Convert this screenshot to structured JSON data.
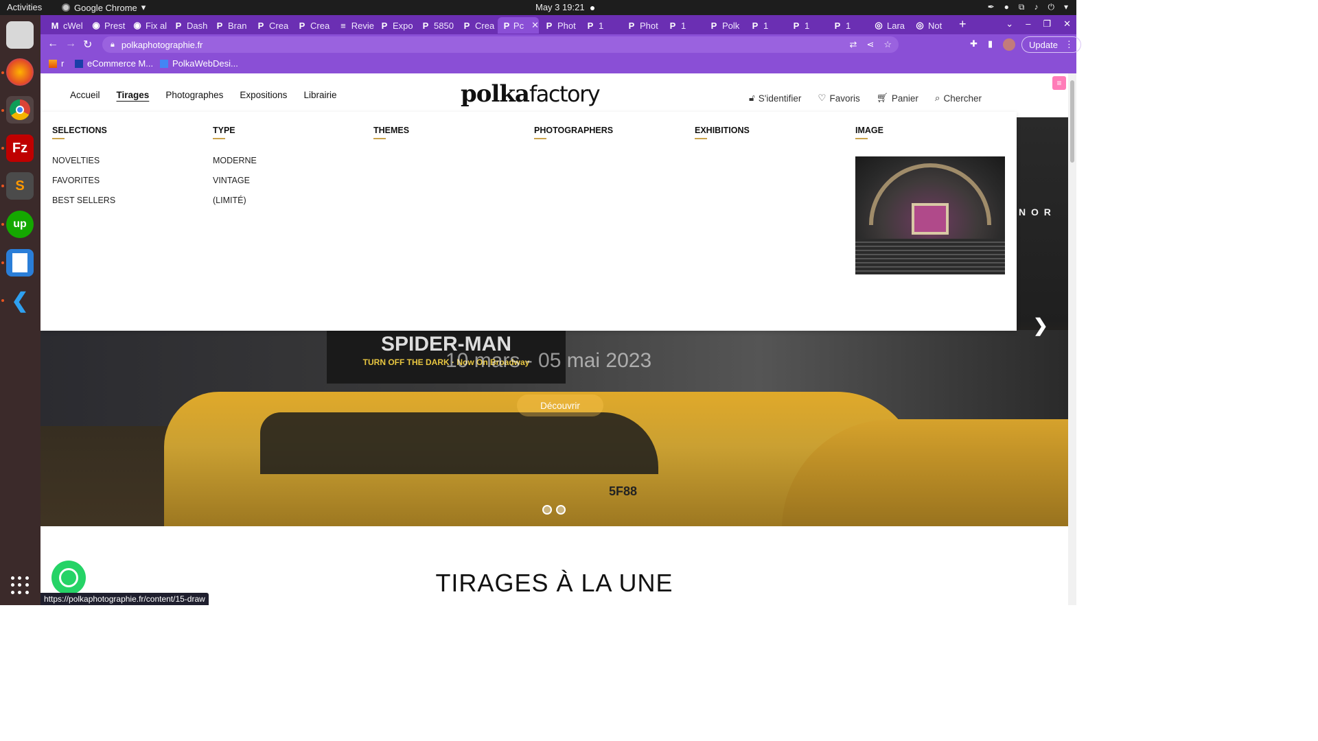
{
  "os": {
    "activities": "Activities",
    "app_name": "Google Chrome",
    "clock": "May 3  19:21"
  },
  "dock": {
    "apps": [
      "files",
      "firefox",
      "chrome",
      "filezilla",
      "sublime-text",
      "upwork",
      "writer",
      "vscode"
    ],
    "labels": {
      "filezilla": "Fz",
      "sublime": "S",
      "upwork": "up"
    }
  },
  "browser": {
    "tabs": [
      "cWel",
      "Prest",
      "Fix al",
      "Dash",
      "Bran",
      "Crea",
      "Crea",
      "Revie",
      "Expo",
      "5850",
      "Crea",
      "Pc",
      "Phot",
      "1",
      "Phot",
      "1",
      "Polk",
      "1",
      "1",
      "1",
      "Lara",
      "Not"
    ],
    "active_tab_index": 11,
    "url": "polkaphotographie.fr",
    "update_label": "Update",
    "bookmarks": [
      "r",
      "eCommerce M...",
      "PolkaWebDesi..."
    ]
  },
  "site": {
    "nav": [
      "Accueil",
      "Tirages",
      "Photographes",
      "Expositions",
      "Librairie"
    ],
    "active_nav": "Tirages",
    "logo_bold": "polka",
    "logo_light": "factory",
    "user_nav": {
      "login": "S'identifier",
      "favorites": "Favoris",
      "cart": "Panier",
      "search": "Chercher"
    },
    "mega_menu": {
      "columns": [
        {
          "heading": "SELECTIONS",
          "items": [
            "NOVELTIES",
            "FAVORITES",
            "BEST SELLERS"
          ]
        },
        {
          "heading": "TYPE",
          "items": [
            "MODERNE",
            "VINTAGE",
            "(LIMITÉ)"
          ]
        },
        {
          "heading": "THEMES",
          "items": []
        },
        {
          "heading": "PHOTOGRAPHERS",
          "items": []
        },
        {
          "heading": "EXHIBITIONS",
          "items": []
        },
        {
          "heading": "IMAGE",
          "items": []
        }
      ]
    },
    "hero": {
      "billboard_title": "SPIDER-MAN",
      "billboard_sub": "TURN OFF THE DARK",
      "billboard_tag": "Now On Broadway",
      "date": "10 mars - 05 mai 2023",
      "cta": "Découvrir",
      "plate": "5F88",
      "slides": 2
    },
    "section_title": "TIRAGES À LA UNE"
  },
  "status_url": "https://polkaphotographie.fr/content/15-draw"
}
